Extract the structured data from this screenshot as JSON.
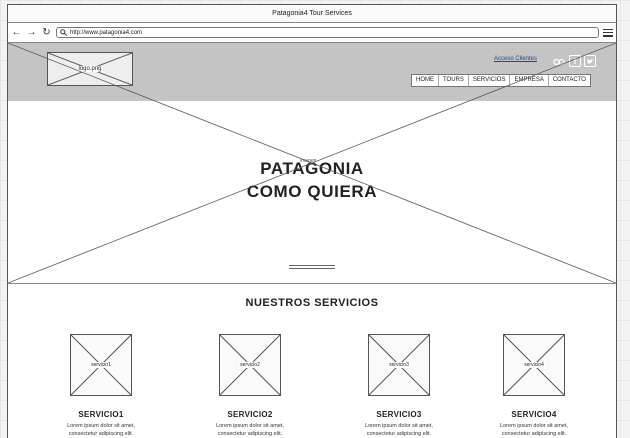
{
  "window": {
    "title": "Patagonia4 Tour Services"
  },
  "browser": {
    "url": "http://www.patagonia4.com"
  },
  "header": {
    "logo_label": "logo.png",
    "acceso_link": "Acceso Clientes",
    "social": [
      "tripadvisor-icon",
      "facebook-icon",
      "twitter-icon"
    ],
    "nav": [
      "HOME",
      "TOURS",
      "SERVICIOS",
      "EMPRESA",
      "CONTACTO"
    ]
  },
  "hero": {
    "image_label": "imagen",
    "title_line1": "PATAGONIA",
    "title_line2": "COMO QUIERA"
  },
  "services": {
    "title": "NUESTROS SERVICIOS",
    "items": [
      {
        "image_label": "servicio1",
        "name": "SERVICIO1",
        "desc1": "Lorem ipsum dolor sit amet,",
        "desc2": "consectetur adipiscing elit."
      },
      {
        "image_label": "servicio2",
        "name": "SERVICIO2",
        "desc1": "Lorem ipsum dolor sit amet,",
        "desc2": "consectetur adipiscing elit."
      },
      {
        "image_label": "servicio3",
        "name": "SERVICIO3",
        "desc1": "Lorem ipsum dolor sit amet,",
        "desc2": "consectetur adipiscing elit."
      },
      {
        "image_label": "servicio4",
        "name": "SERVICIO4",
        "desc1": "Lorem ipsum dolor sit amet,",
        "desc2": "consectetur adipiscing elit."
      }
    ]
  },
  "colors": {
    "header_bg": "#c4c4c4",
    "link": "#1a4a9e"
  }
}
